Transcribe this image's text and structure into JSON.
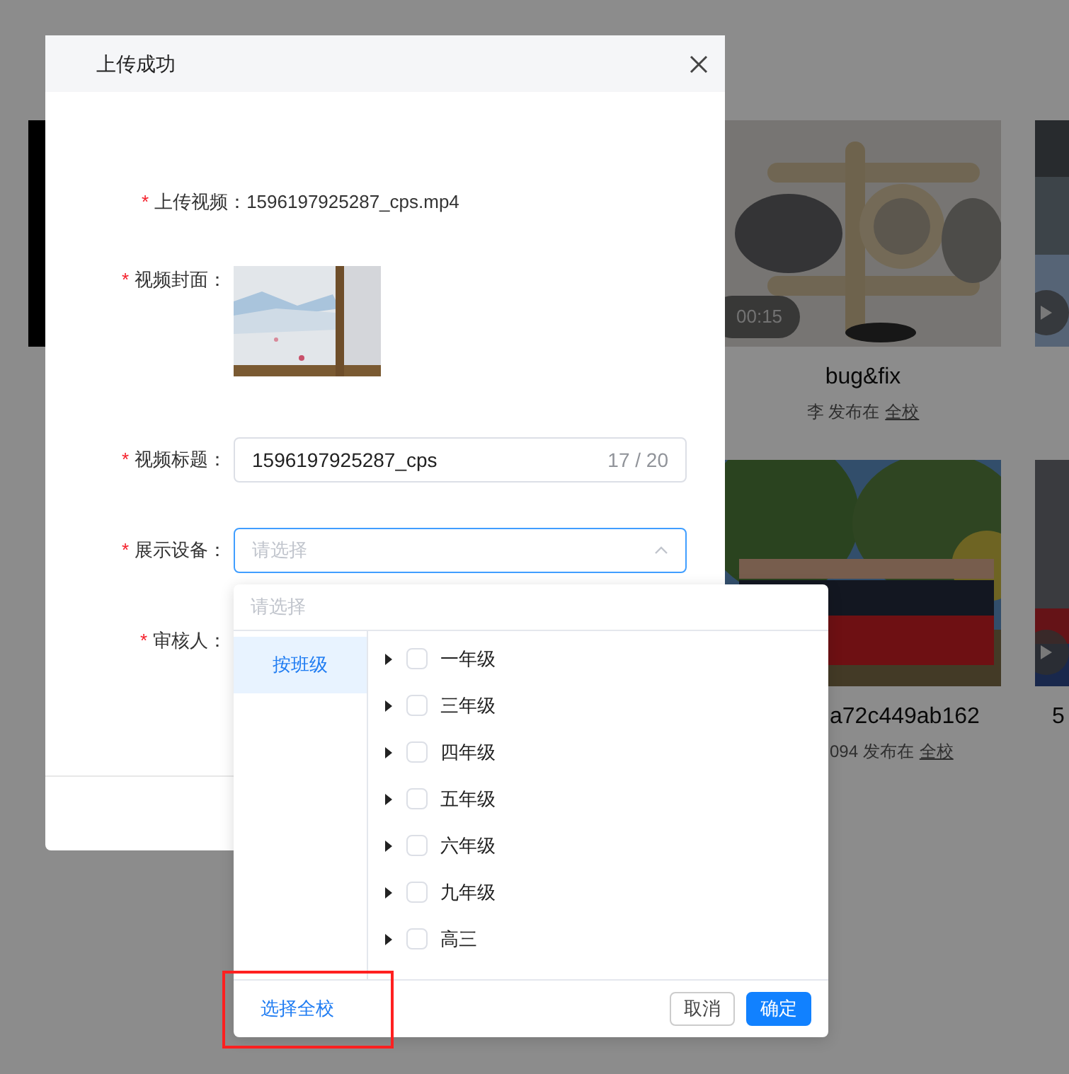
{
  "background_cards": [
    {
      "kind": "cat",
      "duration": "00:15",
      "title": "bug&fix",
      "meta": "李 发布在",
      "scope": "全校"
    },
    {
      "kind": "person",
      "play": true
    },
    {
      "kind": "group",
      "title": "a72c449ab162",
      "meta": "094 发布在",
      "scope": "全校"
    },
    {
      "kind": "kids",
      "play": true,
      "title": "5"
    }
  ],
  "dialog": {
    "title": "上传成功",
    "fields": [
      {
        "kind": "text",
        "marker": "*",
        "label": "上传视频：",
        "value": "1596197925287_cps.mp4"
      },
      {
        "kind": "picture",
        "marker": "*",
        "label": "视频封面："
      },
      {
        "kind": "input",
        "marker": "*",
        "label": "视频标题：",
        "value": "1596197925287_cps",
        "counter": "17 / 20"
      },
      {
        "kind": "select",
        "marker": "*",
        "label": "展示设备：",
        "placeholder": "请选择",
        "expanded": true
      },
      {
        "kind": "empty",
        "marker": "*",
        "label": "审核人："
      }
    ]
  },
  "cascader": {
    "search_placeholder": "请选择",
    "groups": [
      {
        "label": "按班级",
        "selected": true
      }
    ],
    "options": [
      {
        "label": "一年级",
        "checked": false
      },
      {
        "label": "三年级",
        "checked": false
      },
      {
        "label": "四年级",
        "checked": false
      },
      {
        "label": "五年级",
        "checked": false
      },
      {
        "label": "六年级",
        "checked": false
      },
      {
        "label": "九年级",
        "checked": false
      },
      {
        "label": "高三",
        "checked": false
      }
    ],
    "select_all": "选择全校",
    "buttons": [
      {
        "label": "取消",
        "kind": "default"
      },
      {
        "label": "确定",
        "kind": "primary"
      }
    ]
  }
}
